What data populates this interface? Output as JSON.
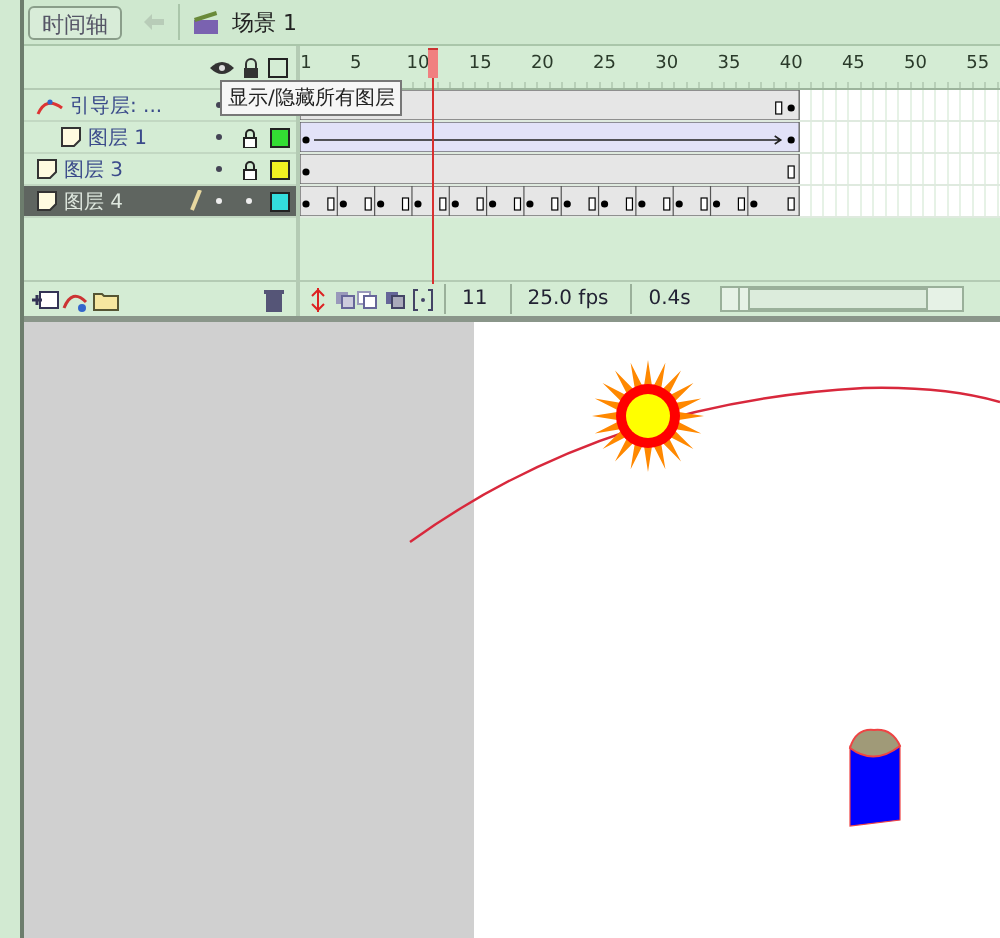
{
  "toolbar": {
    "timeline_button": "时间轴",
    "scene": "场景 1"
  },
  "ruler": {
    "labels": [
      "1",
      "5",
      "10",
      "15",
      "20",
      "25",
      "30",
      "35",
      "40",
      "45",
      "50",
      "55"
    ]
  },
  "tooltip": "显示/隐藏所有图层",
  "layers": [
    {
      "name": "引导层: ...",
      "kind": "guide",
      "frames": {
        "kind": "static-end"
      },
      "selected": false,
      "children": [
        {
          "name": "图层 1",
          "kind": "normal",
          "frames": {
            "kind": "tween"
          },
          "locked": true,
          "color": "#33dd33",
          "selected": false
        }
      ]
    },
    {
      "name": "图层 3",
      "kind": "normal",
      "frames": {
        "kind": "static"
      },
      "locked": true,
      "color": "#eeee22",
      "selected": false
    },
    {
      "name": "图层 4",
      "kind": "normal",
      "frames": {
        "kind": "keyframes"
      },
      "locked": false,
      "editing": true,
      "color": "#33dddd",
      "selected": true
    }
  ],
  "status": {
    "frame": "11",
    "fps": "25.0 fps",
    "time": "0.4s"
  }
}
